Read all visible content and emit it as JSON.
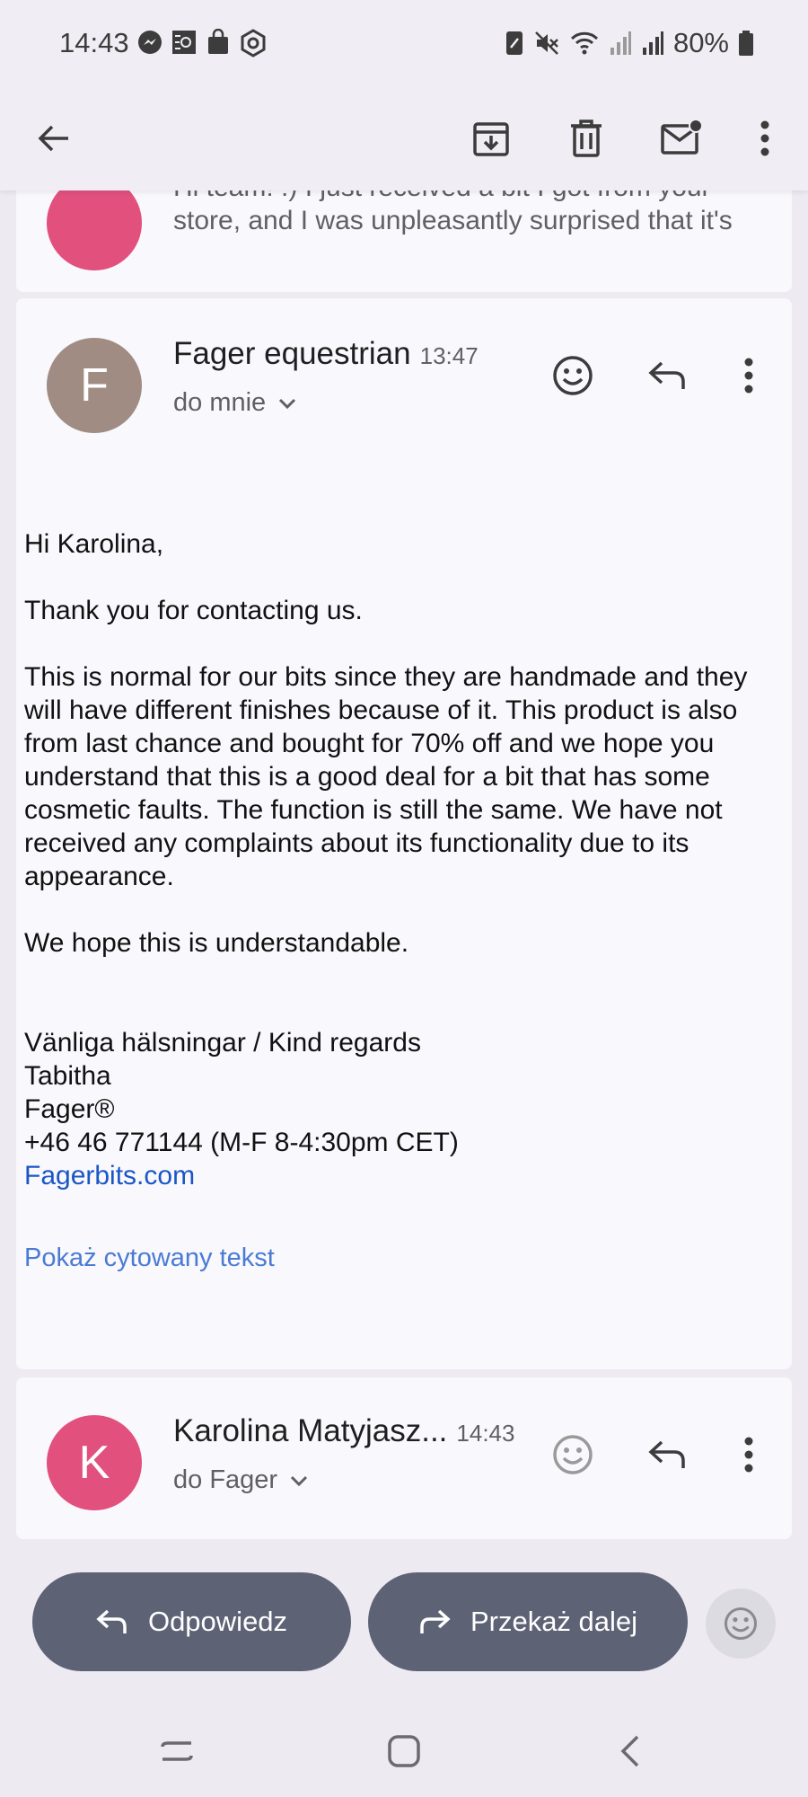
{
  "status_bar": {
    "time": "14:43",
    "battery": "80%",
    "left_icons": [
      "messenger-icon",
      "app-icon",
      "shopping-bag-icon",
      "hexagon-icon"
    ],
    "right_icons": [
      "nfc-icon",
      "mute-icon",
      "wifi-icon",
      "signal-icon",
      "signal-icon",
      "battery-icon"
    ]
  },
  "toolbar": {
    "back": "back-arrow-icon",
    "actions": [
      "archive-icon",
      "delete-icon",
      "mark-unread-icon",
      "more-vert-icon"
    ]
  },
  "previous_message": {
    "snippet": "Hi team! :) I just received a bit I got from your store, and I was unpleasantly surprised that it's"
  },
  "message": {
    "avatar_letter": "F",
    "sender": "Fager equestrian",
    "time": "13:47",
    "recipient": "do mnie",
    "body": {
      "greeting": "Hi Karolina,",
      "p1": "Thank you for contacting us.",
      "p2": "This is normal for our bits since they are handmade and they will have different finishes because of it. This product is also from last chance and bought for 70% off and we hope you understand that this is a good deal for a bit that has some cosmetic faults. The function is still the same. We have not received any complaints about its functionality due to its appearance.",
      "p3": "We hope this is understandable.",
      "sig_regards": "Vänliga hälsningar / Kind regards",
      "sig_name": "Tabitha",
      "sig_company": "Fager®",
      "sig_phone": "+46 46 771144  (M-F 8-4:30pm CET)",
      "sig_link": "Fagerbits.com"
    },
    "show_quoted": "Pokaż cytowany tekst"
  },
  "next_message": {
    "avatar_letter": "K",
    "sender": "Karolina Matyjasz...",
    "time": "14:43",
    "recipient": "do Fager"
  },
  "actions": {
    "reply": "Odpowiedz",
    "forward": "Przekaż dalej"
  },
  "colors": {
    "avatar_f": "#a08c83",
    "avatar_k": "#e2507e",
    "pill": "#5d6275",
    "link": "#1a56c6"
  }
}
